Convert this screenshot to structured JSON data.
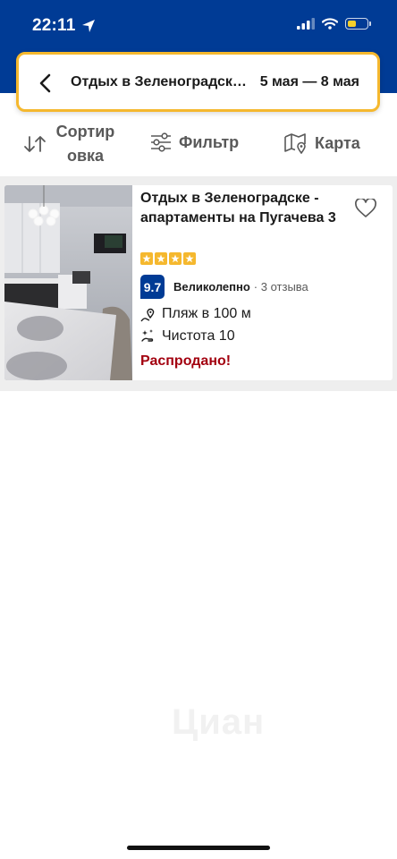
{
  "status_bar": {
    "time": "22:11",
    "icons": [
      "location-arrow-icon",
      "signal-icon",
      "wifi-icon",
      "battery-icon"
    ],
    "battery_color": "#f5cf2b"
  },
  "search": {
    "title": "Отдых в Зеленоградск…",
    "dates": "5 мая — 8 мая"
  },
  "toolbar": {
    "sort_label": "Сортир овка",
    "filter_label": "Фильтр",
    "map_label": "Карта"
  },
  "listing": {
    "name": "Отдых в Зеленоградске - апартаменты на Пугачева 3",
    "stars": 4,
    "score": "9.7",
    "rating_word": "Великолепно",
    "reviews": "· 3 отзыва",
    "features": [
      {
        "icon": "beach-pin-icon",
        "text": "Пляж в 100 м"
      },
      {
        "icon": "sparkle-hand-icon",
        "text": "Чистота 10"
      }
    ],
    "availability": "Распродано!"
  },
  "watermark": "Циан",
  "colors": {
    "brand_blue": "#003b95",
    "accent_yellow": "#f5b82e",
    "soldout_red": "#a3000f"
  }
}
